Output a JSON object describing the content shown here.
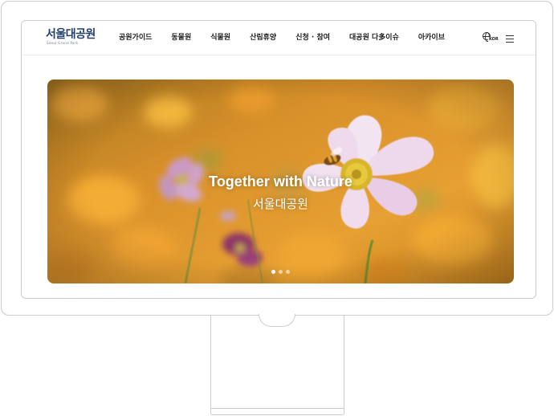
{
  "logo": {
    "name": "서울대공원",
    "subtitle": "Seoul Grand Park"
  },
  "nav": {
    "items": [
      {
        "label": "공원가이드"
      },
      {
        "label": "동물원"
      },
      {
        "label": "식물원"
      },
      {
        "label": "산림휴양"
      },
      {
        "label": "신청 · 참여"
      },
      {
        "label": "대공원 다多이슈"
      },
      {
        "label": "아카이브"
      }
    ]
  },
  "header_utils": {
    "language_label": "KOR",
    "language_icon": "globe-icon",
    "menu_icon": "hamburger-menu-icon"
  },
  "hero": {
    "title": "Together with Nature",
    "subtitle": "서울대공원",
    "slide_count": 3,
    "active_slide": 1
  },
  "colors": {
    "logo": "#23406b",
    "nav_text": "#1f1f1f",
    "frame_border": "#c9ccd1",
    "hero_background": "#e39a2a",
    "flower_petal": "#f5e6f3",
    "flower_center": "#e8c43a"
  }
}
